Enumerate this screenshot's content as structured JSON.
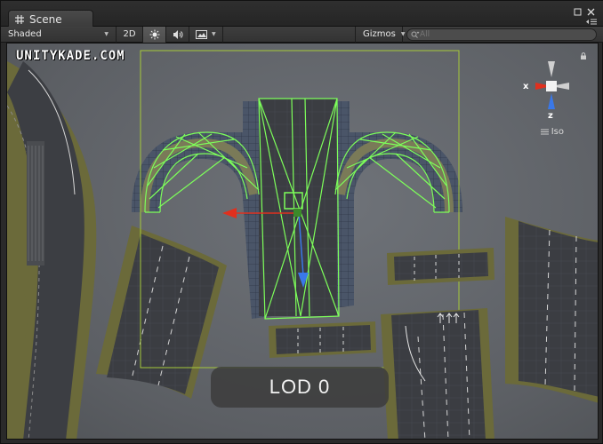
{
  "tab": {
    "title": "Scene"
  },
  "toolbar": {
    "shading_mode": "Shaded",
    "mode_2d": "2D",
    "gizmos_label": "Gizmos",
    "search_placeholder": "All"
  },
  "viewport": {
    "watermark": "UNITYKADE.COM",
    "lod_label": "LOD 0",
    "view_mode": "Iso",
    "axis_labels": {
      "x": "x",
      "z": "z"
    }
  },
  "colors": {
    "wireframe": "#7dff5a",
    "selection_box": "#a6c93a",
    "asphalt": "#3e4045",
    "grass": "#6b6a3a",
    "axis_x": "#e0301e",
    "axis_z": "#3a78e8"
  },
  "icons": [
    "scene-grid-icon",
    "sun-icon",
    "audio-icon",
    "image-effects-icon",
    "lock-icon",
    "menu-icon",
    "search-icon"
  ]
}
